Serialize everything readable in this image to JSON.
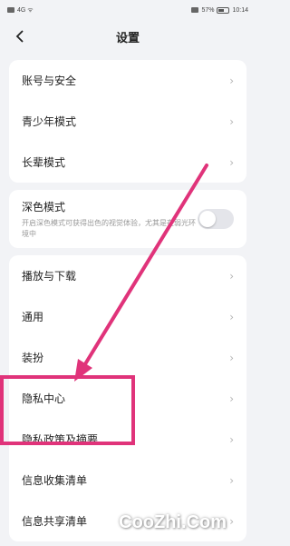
{
  "status_bar": {
    "left": "4G ᯤ",
    "battery": "57%",
    "time": "10:14"
  },
  "header": {
    "title": "设置",
    "back_icon": "chevron-left-icon"
  },
  "groups": [
    {
      "items": [
        {
          "label": "账号与安全"
        },
        {
          "label": "青少年模式"
        },
        {
          "label": "长辈模式"
        }
      ]
    }
  ],
  "dark_mode": {
    "title": "深色模式",
    "description": "开启深色模式可获得出色的视觉体验，尤其是在弱光环境中",
    "enabled": false
  },
  "groups2": [
    {
      "items": [
        {
          "label": "播放与下载"
        },
        {
          "label": "通用"
        },
        {
          "label": "装扮"
        },
        {
          "label": "隐私中心"
        },
        {
          "label": "隐私政策及摘要"
        },
        {
          "label": "信息收集清单"
        },
        {
          "label": "信息共享清单"
        }
      ]
    }
  ],
  "chevron": "›",
  "annotation": {
    "highlight_color": "#e0337a",
    "arrow_color": "#e0337a"
  },
  "watermark": "CooZhi.Com"
}
